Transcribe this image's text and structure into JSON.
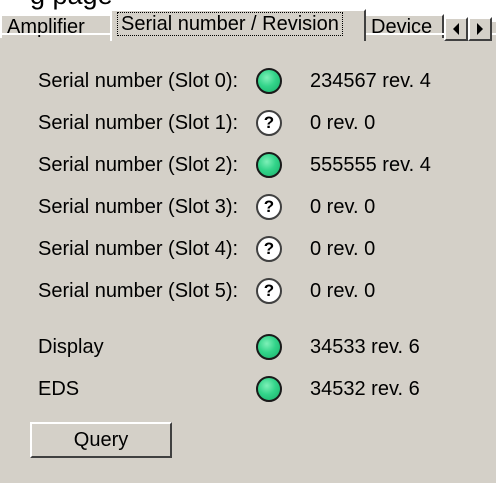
{
  "window_fragment_text": "g page",
  "tabs": [
    {
      "label": "Amplifier",
      "active": false
    },
    {
      "label": "Serial number / Revision",
      "active": true
    },
    {
      "label": "Device",
      "active": false
    }
  ],
  "serials": [
    {
      "label": "Serial number (Slot 0):",
      "status": "ok",
      "icon": "green-led-icon",
      "value": "234567 rev. 4"
    },
    {
      "label": "Serial number (Slot 1):",
      "status": "unknown",
      "icon": "question-mark-icon",
      "value": "0 rev. 0"
    },
    {
      "label": "Serial number (Slot 2):",
      "status": "ok",
      "icon": "green-led-icon",
      "value": "555555 rev. 4"
    },
    {
      "label": "Serial number (Slot 3):",
      "status": "unknown",
      "icon": "question-mark-icon",
      "value": "0 rev. 0"
    },
    {
      "label": "Serial number (Slot 4):",
      "status": "unknown",
      "icon": "question-mark-icon",
      "value": "0 rev. 0"
    },
    {
      "label": "Serial number (Slot 5):",
      "status": "unknown",
      "icon": "question-mark-icon",
      "value": "0 rev. 0"
    }
  ],
  "devices": [
    {
      "label": "Display",
      "status": "ok",
      "icon": "green-led-icon",
      "value": "34533 rev. 6"
    },
    {
      "label": "EDS",
      "status": "ok",
      "icon": "green-led-icon",
      "value": "34532 rev. 6"
    }
  ],
  "unknown_glyph": "?",
  "query_button_label": "Query",
  "colors": {
    "background": "#d4d0c8",
    "led_green": "#33d48a"
  }
}
